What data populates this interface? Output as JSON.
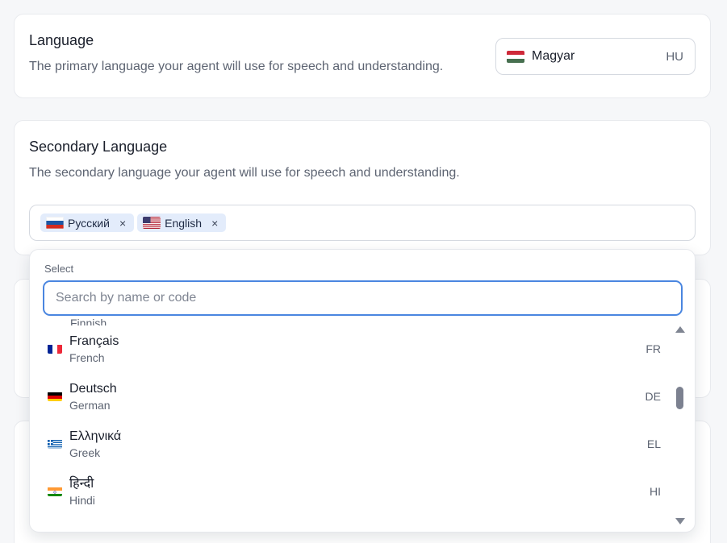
{
  "language": {
    "title": "Language",
    "description": "The primary language your agent will use for speech and understanding.",
    "selected": {
      "name": "Magyar",
      "code": "HU",
      "flag_icon": "hungary-flag-icon"
    }
  },
  "secondary_language": {
    "title": "Secondary Language",
    "description": "The secondary language your agent will use for speech and understanding.",
    "chips": [
      {
        "label": "Русский",
        "flag_icon": "russia-flag-icon",
        "remove_label": "×"
      },
      {
        "label": "English",
        "flag_icon": "us-flag-icon",
        "remove_label": "×"
      }
    ]
  },
  "dropdown": {
    "label": "Select",
    "search_placeholder": "Search by name or code",
    "search_value": "",
    "partial_item": "Finnish",
    "items": [
      {
        "native": "Français",
        "english": "French",
        "code": "FR",
        "flag_icon": "france-flag-icon"
      },
      {
        "native": "Deutsch",
        "english": "German",
        "code": "DE",
        "flag_icon": "germany-flag-icon"
      },
      {
        "native": "Ελληνικά",
        "english": "Greek",
        "code": "EL",
        "flag_icon": "greece-flag-icon"
      },
      {
        "native": "हिन्दी",
        "english": "Hindi",
        "code": "HI",
        "flag_icon": "india-flag-icon"
      }
    ]
  },
  "colors": {
    "accent": "#4a86e0",
    "chip_bg": "#e3ecfb",
    "page_bg": "#f6f7f9"
  }
}
